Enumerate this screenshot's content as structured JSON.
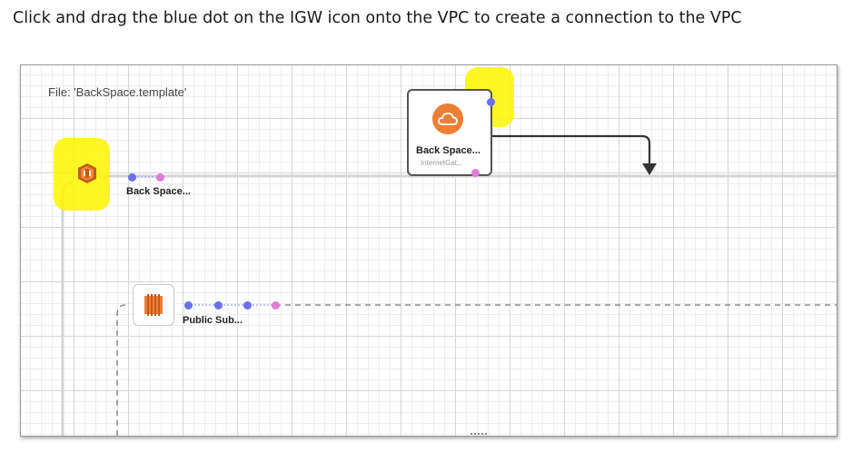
{
  "instruction": "Click and drag the blue dot on the IGW icon onto the VPC to create a connection to the VPC",
  "canvas": {
    "file_label": "File: 'BackSpace.template'"
  },
  "vpc_node": {
    "label": "Back Space...",
    "icon": "vpc-icon"
  },
  "igw_node": {
    "label": "Back Space...",
    "sublabel": "InternetGat...",
    "icon": "cloud-icon"
  },
  "subnet_node": {
    "label": "Public Sub...",
    "icon": "subnet-icon"
  },
  "colors": {
    "highlight": "#fff500",
    "blue_dot": "#6b6ff0",
    "pink_dot": "#e27ad8",
    "aws_orange": "#ef7e35"
  }
}
